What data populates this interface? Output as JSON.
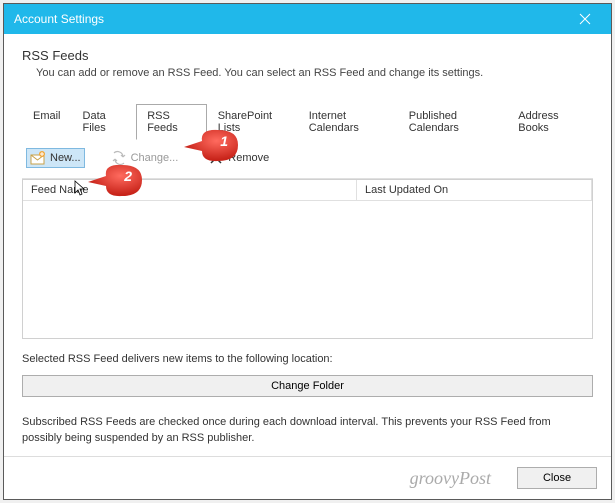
{
  "titlebar": {
    "title": "Account Settings"
  },
  "heading": "RSS Feeds",
  "subheading": "You can add or remove an RSS Feed. You can select an RSS Feed and change its settings.",
  "tabs": {
    "email": "Email",
    "datafiles": "Data Files",
    "rss": "RSS Feeds",
    "sharepoint": "SharePoint Lists",
    "internet": "Internet Calendars",
    "published": "Published Calendars",
    "address": "Address Books"
  },
  "toolbar": {
    "new_label": "New...",
    "change_label": "Change...",
    "remove_label": "Remove"
  },
  "columns": {
    "feed_name": "Feed Name",
    "last_updated": "Last Updated On"
  },
  "below_text": "Selected RSS Feed delivers new items to the following location:",
  "change_folder_label": "Change Folder",
  "note": "Subscribed RSS Feeds are checked once during each download interval. This prevents your RSS Feed from possibly being suspended by an RSS publisher.",
  "close_label": "Close",
  "watermark": "groovyPost",
  "annotations": {
    "one": "1",
    "two": "2"
  }
}
